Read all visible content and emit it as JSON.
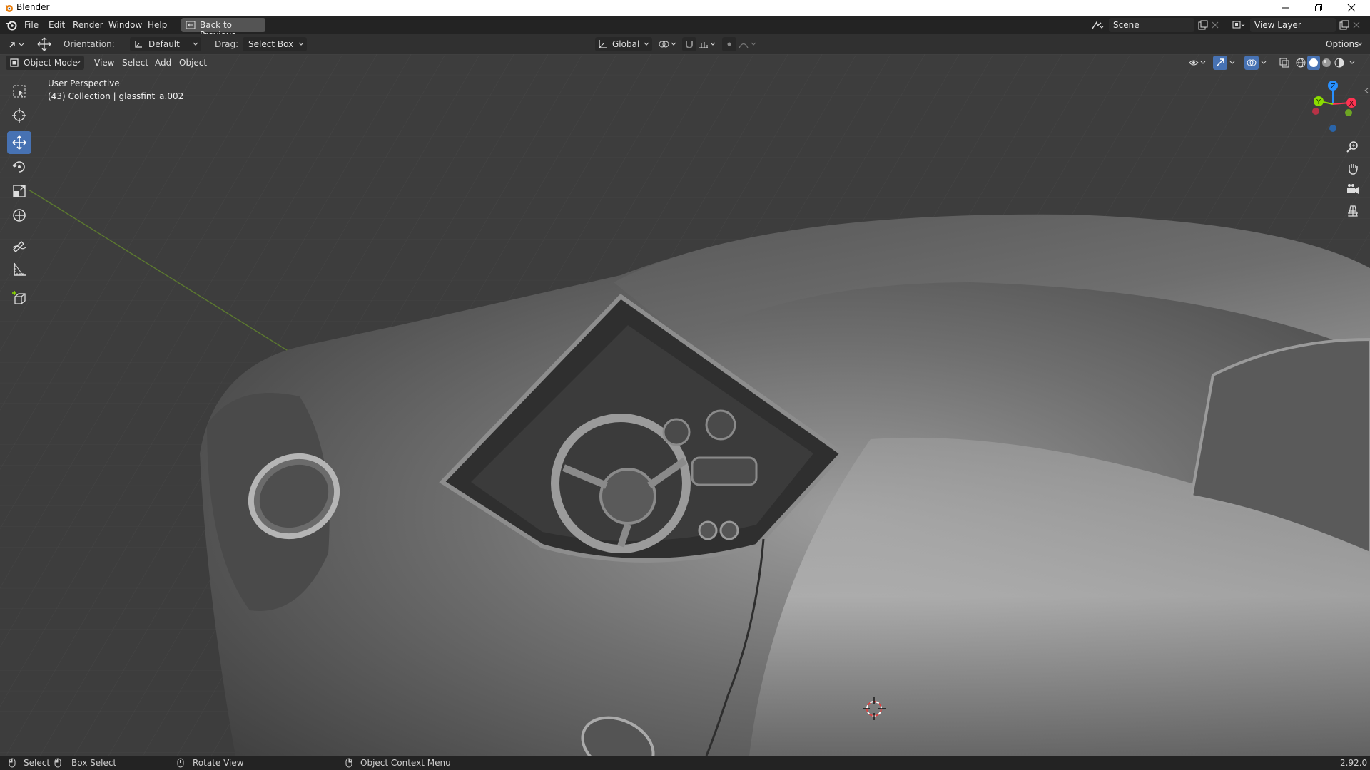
{
  "window": {
    "title": "Blender"
  },
  "menu": {
    "items": [
      "File",
      "Edit",
      "Render",
      "Window",
      "Help"
    ],
    "back_button": "Back to Previous"
  },
  "scene": {
    "name": "Scene",
    "view_layer": "View Layer"
  },
  "tool_settings": {
    "orientation_label": "Orientation:",
    "orientation_value": "Default",
    "drag_label": "Drag:",
    "drag_value": "Select Box",
    "transform_orientation": "Global",
    "options_label": "Options"
  },
  "viewport_header": {
    "mode": "Object Mode",
    "menus": [
      "View",
      "Select",
      "Add",
      "Object"
    ]
  },
  "viewport": {
    "perspective": "User Perspective",
    "collection_info": "(43) Collection | glassfint_a.002",
    "gizmo_axes": {
      "x": "X",
      "y": "Y",
      "z": "Z"
    }
  },
  "toolbar": {
    "tools": [
      "select-box",
      "cursor",
      "move",
      "rotate",
      "scale",
      "transform",
      "annotate",
      "measure",
      "add-cube"
    ],
    "active": "move"
  },
  "status": {
    "select": "Select",
    "box_select": "Box Select",
    "rotate_view": "Rotate View",
    "context_menu": "Object Context Menu",
    "version": "2.92.0"
  },
  "colors": {
    "accent": "#4772b3",
    "viewport_bg": "#3d3d3d",
    "axis_x": "#ff3352",
    "axis_y": "#8bdc00",
    "axis_z": "#2890ff"
  }
}
